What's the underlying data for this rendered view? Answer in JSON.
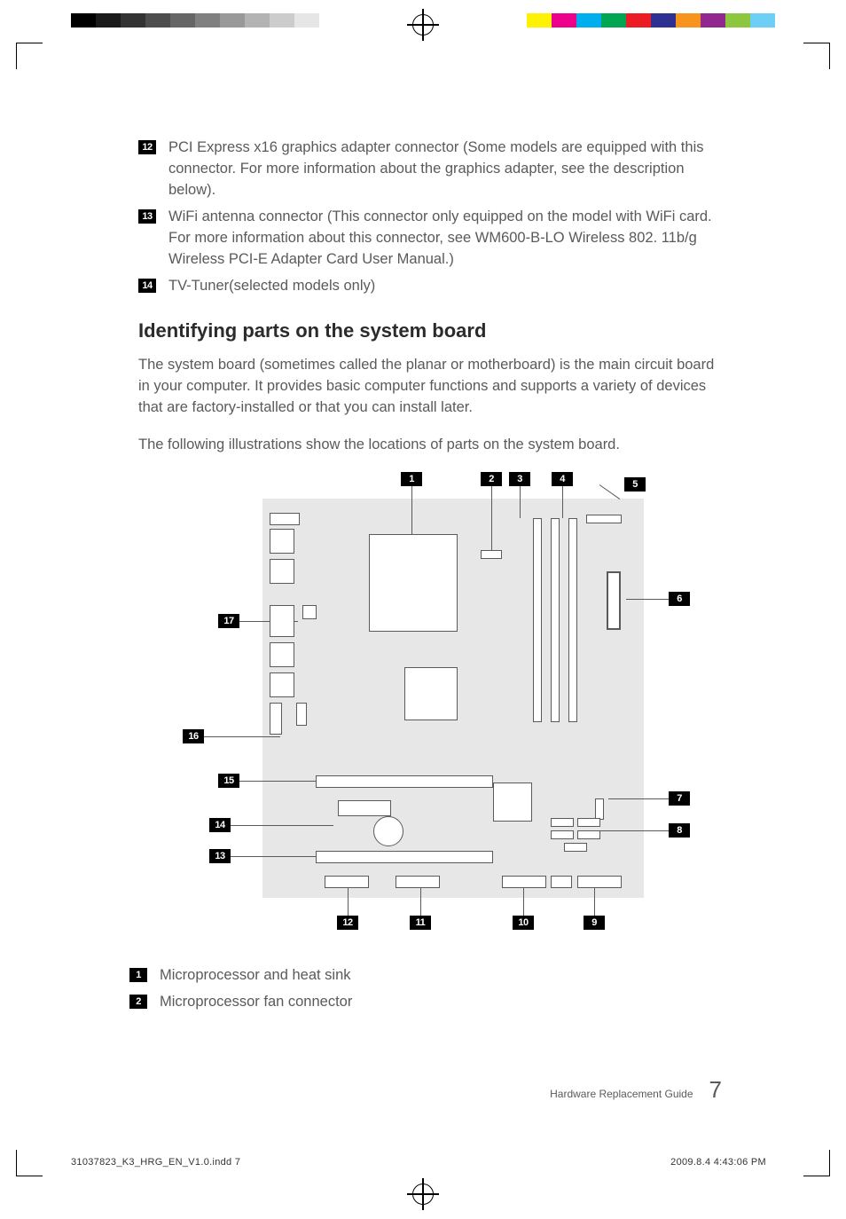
{
  "top_list": [
    {
      "n": "12",
      "text": "PCI Express x16 graphics adapter connector (Some models are equipped with this connector. For more information about the graphics adapter, see the description below)."
    },
    {
      "n": "13",
      "text": "WiFi antenna connector (This connector only equipped on the model with WiFi card. For more information about this connector, see WM600-B-LO Wireless 802. 11b/g Wireless PCI-E Adapter Card User Manual.)"
    },
    {
      "n": "14",
      "text": "TV-Tuner(selected models only)"
    }
  ],
  "section_heading": "Identifying parts on the system board",
  "para1": "The system board (sometimes called the planar or motherboard) is the main circuit board in your computer. It provides basic computer functions and supports a variety of devices that are factory-installed or that you can install later.",
  "para2": "The following illustrations show the locations of parts on the system board.",
  "diagram_callouts": [
    "1",
    "2",
    "3",
    "4",
    "5",
    "6",
    "7",
    "8",
    "9",
    "10",
    "11",
    "12",
    "13",
    "14",
    "15",
    "16",
    "17"
  ],
  "key_list": [
    {
      "n": "1",
      "text": "Microprocessor and heat sink"
    },
    {
      "n": "2",
      "text": "Microprocessor fan connector"
    }
  ],
  "footer_title": "Hardware Replacement Guide",
  "footer_page": "7",
  "slug_left": "31037823_K3_HRG_EN_V1.0.indd   7",
  "slug_right": "2009.8.4   4:43:06 PM"
}
